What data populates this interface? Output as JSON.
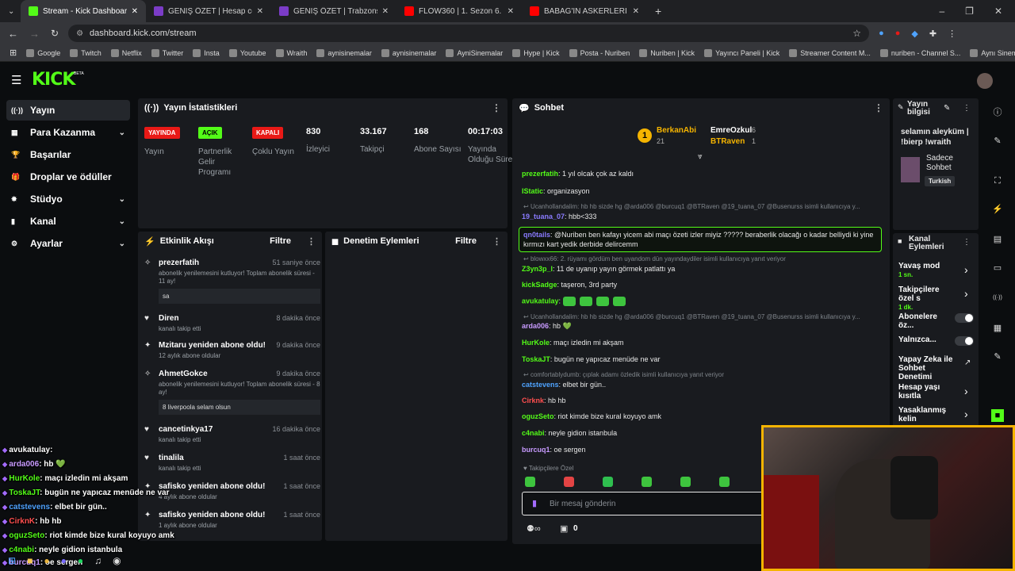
{
  "browser": {
    "tabs": [
      {
        "title": "Stream - Kick Dashboard",
        "color": "#53fc18",
        "active": true
      },
      {
        "title": "GENİŞ ÖZET | Hesap com Antal...",
        "color": "#7b3cc7"
      },
      {
        "title": "GENİŞ ÖZET | Trabzonspor 3-3 ...",
        "color": "#7b3cc7"
      },
      {
        "title": "FLOW360 | 1. Sezon 6. Bölüm | ...",
        "color": "#ff0000"
      },
      {
        "title": "BABAG'IN ASKERLERİ 113'ÜN P...",
        "color": "#ff0000"
      }
    ],
    "url": "dashboard.kick.com/stream",
    "bookmarks": [
      "Google",
      "Twitch",
      "Netflix",
      "Twitter",
      "Insta",
      "Youtube",
      "Wraith",
      "aynisinemalar",
      "aynisinemalar",
      "AyniSinemalar",
      "Hype | Kick",
      "Posta - Nuriben",
      "Nuriben | Kick",
      "Yayıncı Paneli | Kick",
      "Streamer Content M...",
      "nuriben - Channel S...",
      "Aynı Sinemalar - Ça..."
    ]
  },
  "kick": {
    "logo": "KICK",
    "beta": "BETA"
  },
  "sidebar": {
    "items": [
      {
        "label": "Yayın",
        "icon": "broadcast-icon",
        "glyph": "((·))",
        "active": true
      },
      {
        "label": "Para Kazanma",
        "icon": "money-icon",
        "glyph": "▦",
        "chev": true
      },
      {
        "label": "Başarılar",
        "icon": "trophy-icon",
        "glyph": "🏆"
      },
      {
        "label": "Droplar ve ödüller",
        "icon": "gift-icon",
        "glyph": "🎁"
      },
      {
        "label": "Stüdyo",
        "icon": "studio-icon",
        "glyph": "✸",
        "chev": true
      },
      {
        "label": "Kanal",
        "icon": "channel-icon",
        "glyph": "▮",
        "chev": true
      },
      {
        "label": "Ayarlar",
        "icon": "gear-icon",
        "glyph": "⚙",
        "chev": true
      }
    ]
  },
  "stats": {
    "title": "Yayın İstatistikleri",
    "items": [
      {
        "badge": "YAYINDA",
        "badge_color": "#e91916",
        "label": "Yayın"
      },
      {
        "badge": "AÇIK",
        "badge_color": "#53fc18",
        "label": "Partnerlik Gelir Programı"
      },
      {
        "badge": "KAPALI",
        "badge_color": "#e91916",
        "label": "Çoklu Yayın"
      },
      {
        "num": "830",
        "label": "İzleyici"
      },
      {
        "num": "33.167",
        "label": "Takipçi"
      },
      {
        "num": "168",
        "label": "Abone Sayısı"
      },
      {
        "num": "00:17:03",
        "label": "Yayında Olduğu Süre"
      }
    ]
  },
  "activity": {
    "title": "Etkinlik Akışı",
    "filter": "Filtre",
    "events": [
      {
        "name": "prezerfatih",
        "time": "51 saniye önce",
        "sub": "abonelik yenilemesini kutluyor! Toplam abonelik süresi - 11 ay!",
        "msg": "sa"
      },
      {
        "name": "Diren",
        "time": "8 dakika önce",
        "sub": "kanalı takip etti"
      },
      {
        "name": "Mzitaru yeniden abone oldu!",
        "time": "9 dakika önce",
        "sub": "12 aylık abone oldular"
      },
      {
        "name": "AhmetGokce",
        "time": "9 dakika önce",
        "sub": "abonelik yenilemesini kutluyor! Toplam abonelik süresi - 8 ay!",
        "msg": "8 liverpoola selam olsun"
      },
      {
        "name": "cancetinkya17",
        "time": "16 dakika önce",
        "sub": "kanalı takip etti"
      },
      {
        "name": "tinalila",
        "time": "1 saat önce",
        "sub": "kanalı takip etti"
      },
      {
        "name": "safisko yeniden abone oldu!",
        "time": "1 saat önce",
        "sub": "4 aylık abone oldular"
      },
      {
        "name": "safisko yeniden abone oldu!",
        "time": "1 saat önce",
        "sub": "1 aylık abone oldular"
      }
    ]
  },
  "moderation": {
    "title": "Denetim Eylemleri",
    "filter": "Filtre"
  },
  "chat": {
    "title": "Sohbet",
    "top_gifters": [
      {
        "rank": "1",
        "name": "BerkanAbi",
        "count": "21"
      },
      {
        "name": "EmreOzkul",
        "count": "6"
      },
      {
        "name": "BTRaven",
        "count": "1"
      }
    ],
    "messages": [
      {
        "user": "prezerfatih",
        "color": "#53fc18",
        "text": ": 1 yıl olcak çok az kaldı"
      },
      {
        "user": "IStatic",
        "color": "#53fc18",
        "text": ": organizasyon"
      },
      {
        "reply": "Ucanhollandalim: hb hb sizde hg @arda006 @burcuq1 @BTRaven @19_tuana_07 @Busenurss isimli kullanıcıya y..."
      },
      {
        "user": "19_tuana_07",
        "color": "#8a7bff",
        "text": ": hbb<333"
      },
      {
        "user": "qn0tails",
        "color": "#8a7bff",
        "text": ": @Nuriben ben kafayı yicem abi maçı özeti izler miyiz ????? beraberlik olacağı o kadar belliydi ki yine kırmızı kart yedik derbide delircemm",
        "highlight": true
      },
      {
        "reply": "blowxx66: 2. rüyamı gördüm ben uyandom dün yayındaydiler isimli kullanıcıya yanıt veriyor"
      },
      {
        "user": "Z3yn3p_l",
        "color": "#53fc18",
        "text": ": 11 de uyanıp yayın görmek patlattı ya"
      },
      {
        "user": "kickSadge",
        "color": "#53fc18",
        "text": ": taşeron, 3rd party"
      },
      {
        "user": "avukatulay",
        "color": "#53fc18",
        "text": ":"
      },
      {
        "reply": "Ucanhollandalim: hb hb sizde hg @arda006 @burcuq1 @BTRaven @19_tuana_07 @Busenurss isimli kullanıcıya y..."
      },
      {
        "user": "arda006",
        "color": "#c89bff",
        "text": ": hb 💚"
      },
      {
        "user": "HurKole",
        "color": "#53fc18",
        "text": ": maçı izledin mi akşam"
      },
      {
        "user": "ToskaJT",
        "color": "#53fc18",
        "text": ": bugün ne yapıcaz menüde ne var"
      },
      {
        "reply": "comfortablydumb: çıplak adamı özledik isimli kullanıcıya yanıt veriyor"
      },
      {
        "user": "catstevens",
        "color": "#4fa3ff",
        "text": ": elbet bir gün.."
      },
      {
        "user": "Cirknk",
        "color": "#ff4f4f",
        "text": ": hb hb"
      },
      {
        "user": "oguzSeto",
        "color": "#53fc18",
        "text": ": riot kimde bize kural koyuyo amk"
      },
      {
        "user": "c4nabi",
        "color": "#53fc18",
        "text": ": neyle gidion istanbula"
      },
      {
        "user": "burcuq1",
        "color": "#c89bff",
        "text": ": oe sergen"
      }
    ],
    "followers_only": "Takipçilere Özel",
    "placeholder": "Bir mesaj gönderin",
    "footer_count": "0"
  },
  "stream_info": {
    "title": "Yayın bilgisi",
    "stream_title": "selamın aleyküm | !bierp !wraith",
    "mode": "Sadece Sohbet",
    "language": "Turkish"
  },
  "channel_actions": {
    "title": "Kanal Eylemleri",
    "items": [
      {
        "label": "Yavaş mod",
        "sub": "1 sn."
      },
      {
        "label": "Takipçilere özel s",
        "sub": "1 dk."
      },
      {
        "label": "Abonelere öz..."
      },
      {
        "label": "Yalnızca..."
      },
      {
        "label": "Yapay Zeka ile Sohbet Denetimi"
      },
      {
        "label": "Hesap yaşı kısıtla"
      },
      {
        "label": "Yasaklanmış kelin"
      }
    ]
  },
  "overlay_chat": [
    {
      "user": "avukatulay",
      "text": ":",
      "color": "#ffffff"
    },
    {
      "user": "arda006",
      "text": ": hb 💚",
      "color": "#c89bff"
    },
    {
      "user": "HurKole",
      "text": ": maçı izledin mi akşam",
      "color": "#53fc18"
    },
    {
      "user": "ToskaJT",
      "text": ": bugün ne yapıcaz menüde ne var",
      "color": "#53fc18"
    },
    {
      "user": "catstevens",
      "text": ": elbet bir gün..",
      "color": "#4fa3ff"
    },
    {
      "user": "CirknK",
      "text": ": hb hb",
      "color": "#ff4f4f"
    },
    {
      "user": "oguzSeto",
      "text": ": riot kimde bize kural koyuyo amk",
      "color": "#53fc18"
    },
    {
      "user": "c4nabi",
      "text": ": neyle gidion istanbula",
      "color": "#53fc18"
    },
    {
      "user": "burcuq1",
      "text": ": oe sergen",
      "color": "#c89bff"
    }
  ],
  "colors": {
    "accent": "#53fc18",
    "live": "#e91916",
    "panel": "#191b1f"
  }
}
